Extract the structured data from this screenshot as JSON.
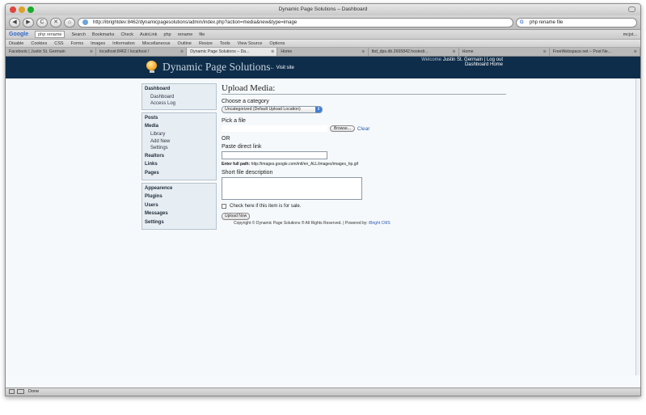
{
  "browser": {
    "window_title": "Dynamic Page Solutions – Dashboard",
    "url": "http://ibrightdev:8462/dynamicpagesolutions/admin/index.php?action=media&new&type=image",
    "search_query": "php rename file",
    "back": "◀",
    "forward": "▶",
    "reload": "C",
    "stop": "✕",
    "home": "⌂"
  },
  "toolbar": {
    "google": "Google",
    "query": "php rename",
    "items": [
      "Search",
      "Bookmarks",
      "Check",
      "AutoLink",
      "php",
      "rename",
      "file"
    ],
    "right": "mcjst..."
  },
  "devbar": {
    "items": [
      "Disable",
      "Cookies",
      "CSS",
      "Forms",
      "Images",
      "Information",
      "Miscellaneous",
      "Outline",
      "Resize",
      "Tools",
      "View Source",
      "Options"
    ]
  },
  "tabs": [
    {
      "label": "Facebook | Justin St. Germain"
    },
    {
      "label": "localhost:8462 / localhost /"
    },
    {
      "label": "Dynamic Page Solutions – Da..."
    },
    {
      "label": "Home"
    },
    {
      "label": "tbd_dps.db.2665842.hostedr..."
    },
    {
      "label": "Home"
    },
    {
      "label": "FreeWebspace.net – Post Ne..."
    }
  ],
  "header": {
    "site_title": "Dynamic Page Solutions",
    "visit_site": "← Visit site",
    "welcome_prefix": "Welcome",
    "user": "Justin St. Germain",
    "separator": "|",
    "logout": "Log out",
    "dashboard_home": "Dashboard Home"
  },
  "sidebar": {
    "group1": {
      "heading": "Dashboard",
      "items": [
        "Dashboard",
        "Access Log"
      ]
    },
    "group2": {
      "posts": "Posts",
      "media": "Media",
      "media_items": [
        "Library",
        "Add New",
        "Settings"
      ],
      "realtors": "Realtors",
      "links": "Links",
      "pages": "Pages"
    },
    "group3": {
      "items": [
        "Appearence",
        "Plugins",
        "Users",
        "Messages",
        "Settings"
      ]
    }
  },
  "main": {
    "heading": "Upload Media:",
    "category_label": "Choose a category",
    "category_selected": "Uncategorized (Default Upload Location)",
    "file_label": "Pick a file",
    "browse": "Browse...",
    "clear": "Clear",
    "or": "OR",
    "link_label": "Paste direct link",
    "hint_bold": "Enter full path:",
    "hint_text": "http://images.google.com/intl/en_ALL/images/images_hp.gif",
    "description_label": "Short file description",
    "sale_label": "Check here if this item is for sale.",
    "upload": "Upload Now",
    "copyright": "Copyright © Dynamic Page Solutions ® All Rights Reserved. | Powered by:",
    "cms": "iBright CMS"
  },
  "status": {
    "text": "Done"
  },
  "colors": {
    "header_bg": "#0e2d4a",
    "accent": "#2a5db0"
  }
}
